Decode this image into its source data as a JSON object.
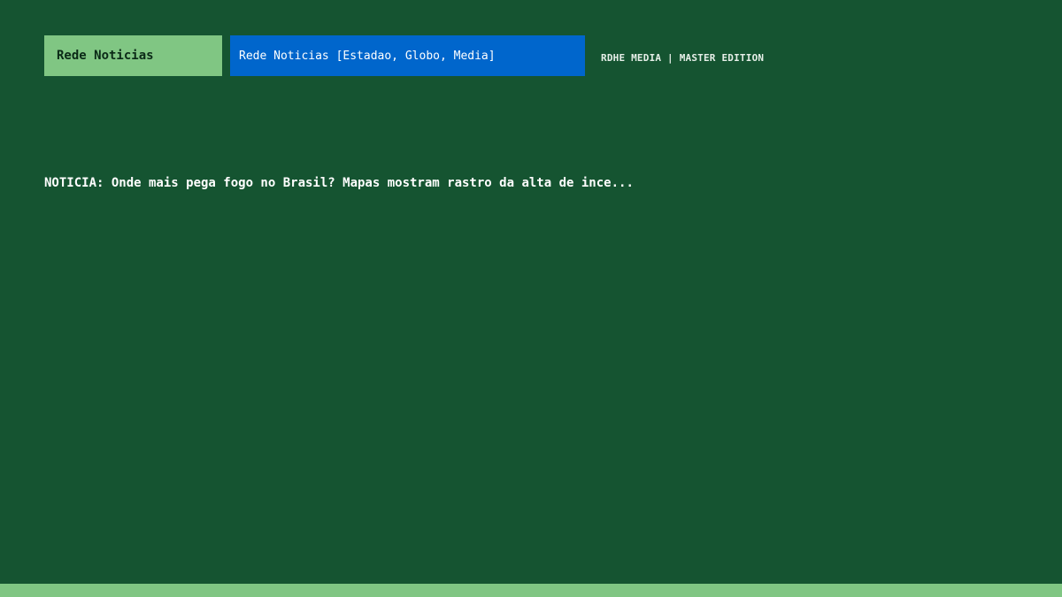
{
  "header": {
    "channel_label": "Rede Noticias",
    "source_field": "Rede Noticias [Estadao, Globo, Media]",
    "edition": "RDHE MEDIA | MASTER EDITION"
  },
  "headline": {
    "text": "NOTICIA: Onde mais pega fogo no Brasil? Mapas mostram rastro da alta de ince..."
  },
  "colors": {
    "background": "#155431",
    "accent_green": "#80c683",
    "accent_blue": "#0066cc"
  }
}
